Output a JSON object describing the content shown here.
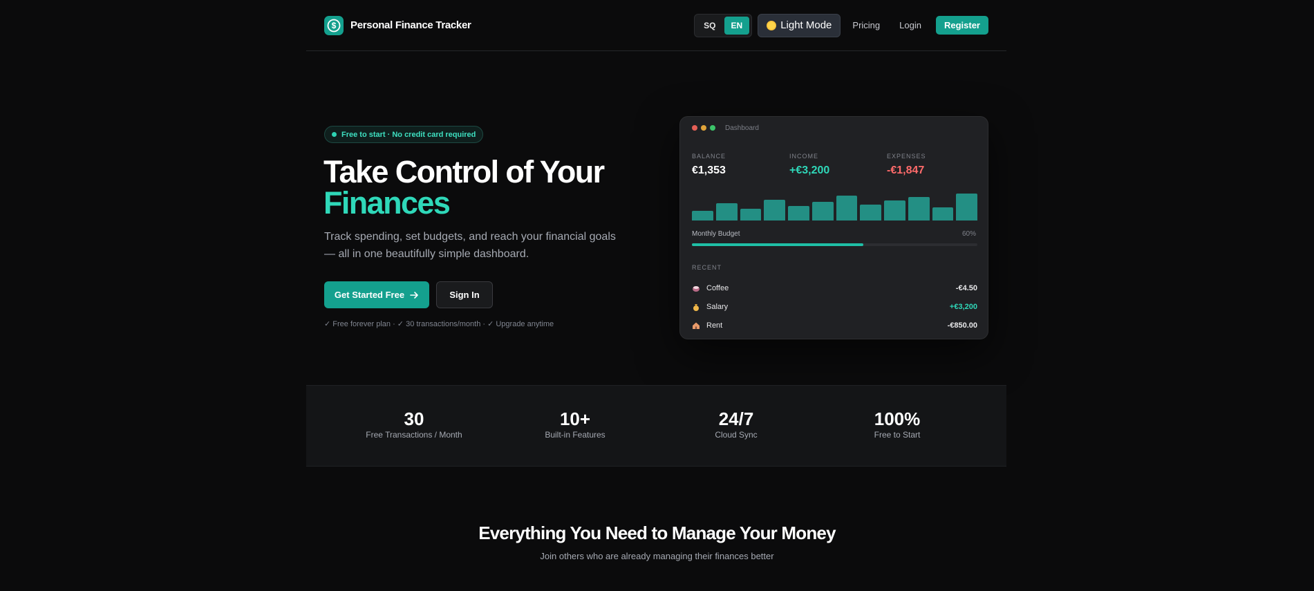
{
  "nav": {
    "brand": "Personal Finance Tracker",
    "languages": [
      {
        "code": "SQ",
        "active": false
      },
      {
        "code": "EN",
        "active": true
      }
    ],
    "mode_label": "Light Mode",
    "pricing": "Pricing",
    "login": "Login",
    "register": "Register"
  },
  "hero": {
    "badge": "Free to start · No credit card required",
    "title_line1": "Take Control of Your",
    "title_line2": "Finances",
    "subtitle": "Track spending, set budgets, and reach your financial goals — all in one beautifully simple dashboard.",
    "cta_primary": "Get Started Free",
    "cta_secondary": "Sign In",
    "note": "✓ Free forever plan · ✓ 30 transactions/month · ✓ Upgrade anytime"
  },
  "dashboard": {
    "title": "Dashboard",
    "balance": {
      "label": "BALANCE",
      "value": "€1,353"
    },
    "income": {
      "label": "INCOME",
      "value": "+€3,200"
    },
    "expenses": {
      "label": "EXPENSES",
      "value": "-€1,847"
    },
    "bar_values": [
      0.33,
      0.6,
      0.4,
      0.72,
      0.5,
      0.65,
      0.85,
      0.55,
      0.7,
      0.8,
      0.45,
      0.92
    ],
    "budget": {
      "label": "Monthly Budget",
      "percent_label": "60%",
      "fraction": 0.6
    },
    "recent_label": "RECENT",
    "transactions": [
      {
        "icon": "coffee-icon",
        "name": "Coffee",
        "amount": "-€4.50",
        "color": "#e8e8ea"
      },
      {
        "icon": "money-bag-icon",
        "name": "Salary",
        "amount": "+€3,200",
        "color": "#2fd8b9"
      },
      {
        "icon": "house-icon",
        "name": "Rent",
        "amount": "-€850.00",
        "color": "#e8e8ea"
      }
    ]
  },
  "stats": [
    {
      "value": "30",
      "label": "Free Transactions / Month"
    },
    {
      "value": "10+",
      "label": "Built-in Features"
    },
    {
      "value": "24/7",
      "label": "Cloud Sync"
    },
    {
      "value": "100%",
      "label": "Free to Start"
    }
  ],
  "features": {
    "title": "Everything You Need to Manage Your Money",
    "subtitle": "Join others who are already managing their finances better"
  },
  "colors": {
    "accent": "#14a08e",
    "accent_text": "#2fd8b9",
    "expense_red": "#ff6b6b",
    "background": "#0b0b0c"
  }
}
